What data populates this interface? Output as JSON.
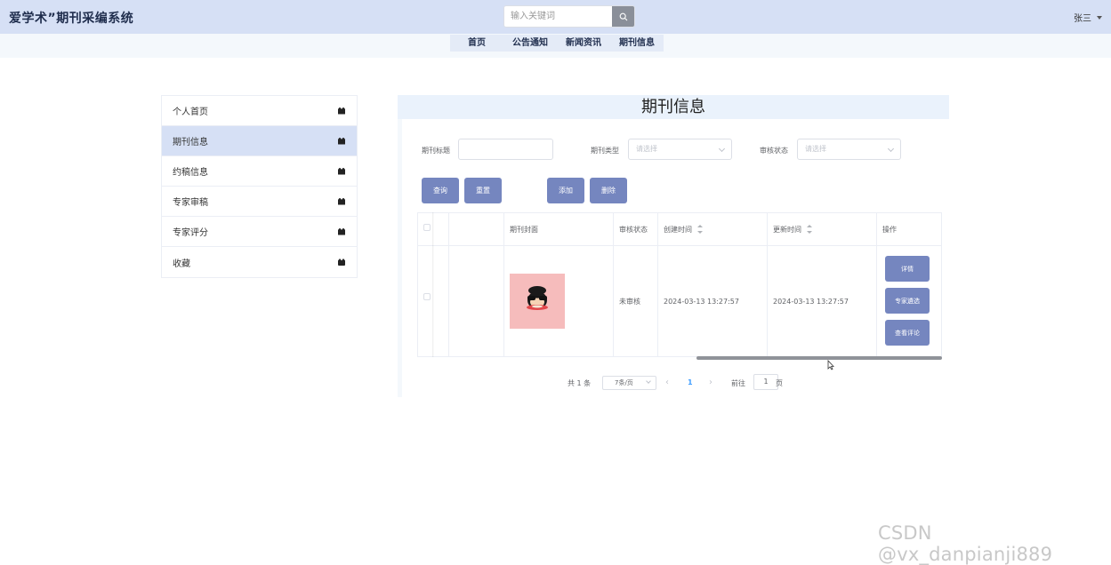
{
  "header": {
    "brand": "爱学术”期刊采编系统",
    "search_placeholder": "输入关键词",
    "user": "张三"
  },
  "nav": {
    "items": [
      "首页",
      "公告通知",
      "新闻资讯",
      "期刊信息"
    ]
  },
  "sidebar": {
    "items": [
      {
        "label": "个人首页",
        "active": false
      },
      {
        "label": "期刊信息",
        "active": true
      },
      {
        "label": "约稿信息",
        "active": false
      },
      {
        "label": "专家审稿",
        "active": false
      },
      {
        "label": "专家评分",
        "active": false
      },
      {
        "label": "收藏",
        "active": false
      }
    ]
  },
  "panel": {
    "title": "期刊信息",
    "filters": {
      "title_label": "期刊标题",
      "type_label": "期刊类型",
      "type_placeholder": "请选择",
      "status_label": "审核状态",
      "status_placeholder": "请选择"
    },
    "buttons": {
      "query": "查询",
      "reset": "重置",
      "add": "添加",
      "delete": "删除"
    },
    "table": {
      "headers": {
        "cover": "期刊封面",
        "status": "审核状态",
        "created": "创建时间",
        "updated": "更新时间",
        "actions": "操作"
      },
      "rows": [
        {
          "status": "未审核",
          "created": "2024-03-13 13:27:57",
          "updated": "2024-03-13 13:27:57",
          "actions": {
            "detail": "详情",
            "expert": "专家遴选",
            "comments": "查看评论"
          }
        }
      ]
    },
    "pagination": {
      "total": "共 1 条",
      "page_size": "7条/页",
      "current_page": "1",
      "goto_label": "前往",
      "goto_value": "1",
      "page_unit": "页"
    }
  },
  "watermark": "CSDN @vx_danpianji889",
  "colors": {
    "header_bg": "#d6e0f5",
    "accent_button": "#7586bf",
    "active_page": "#409eff"
  }
}
